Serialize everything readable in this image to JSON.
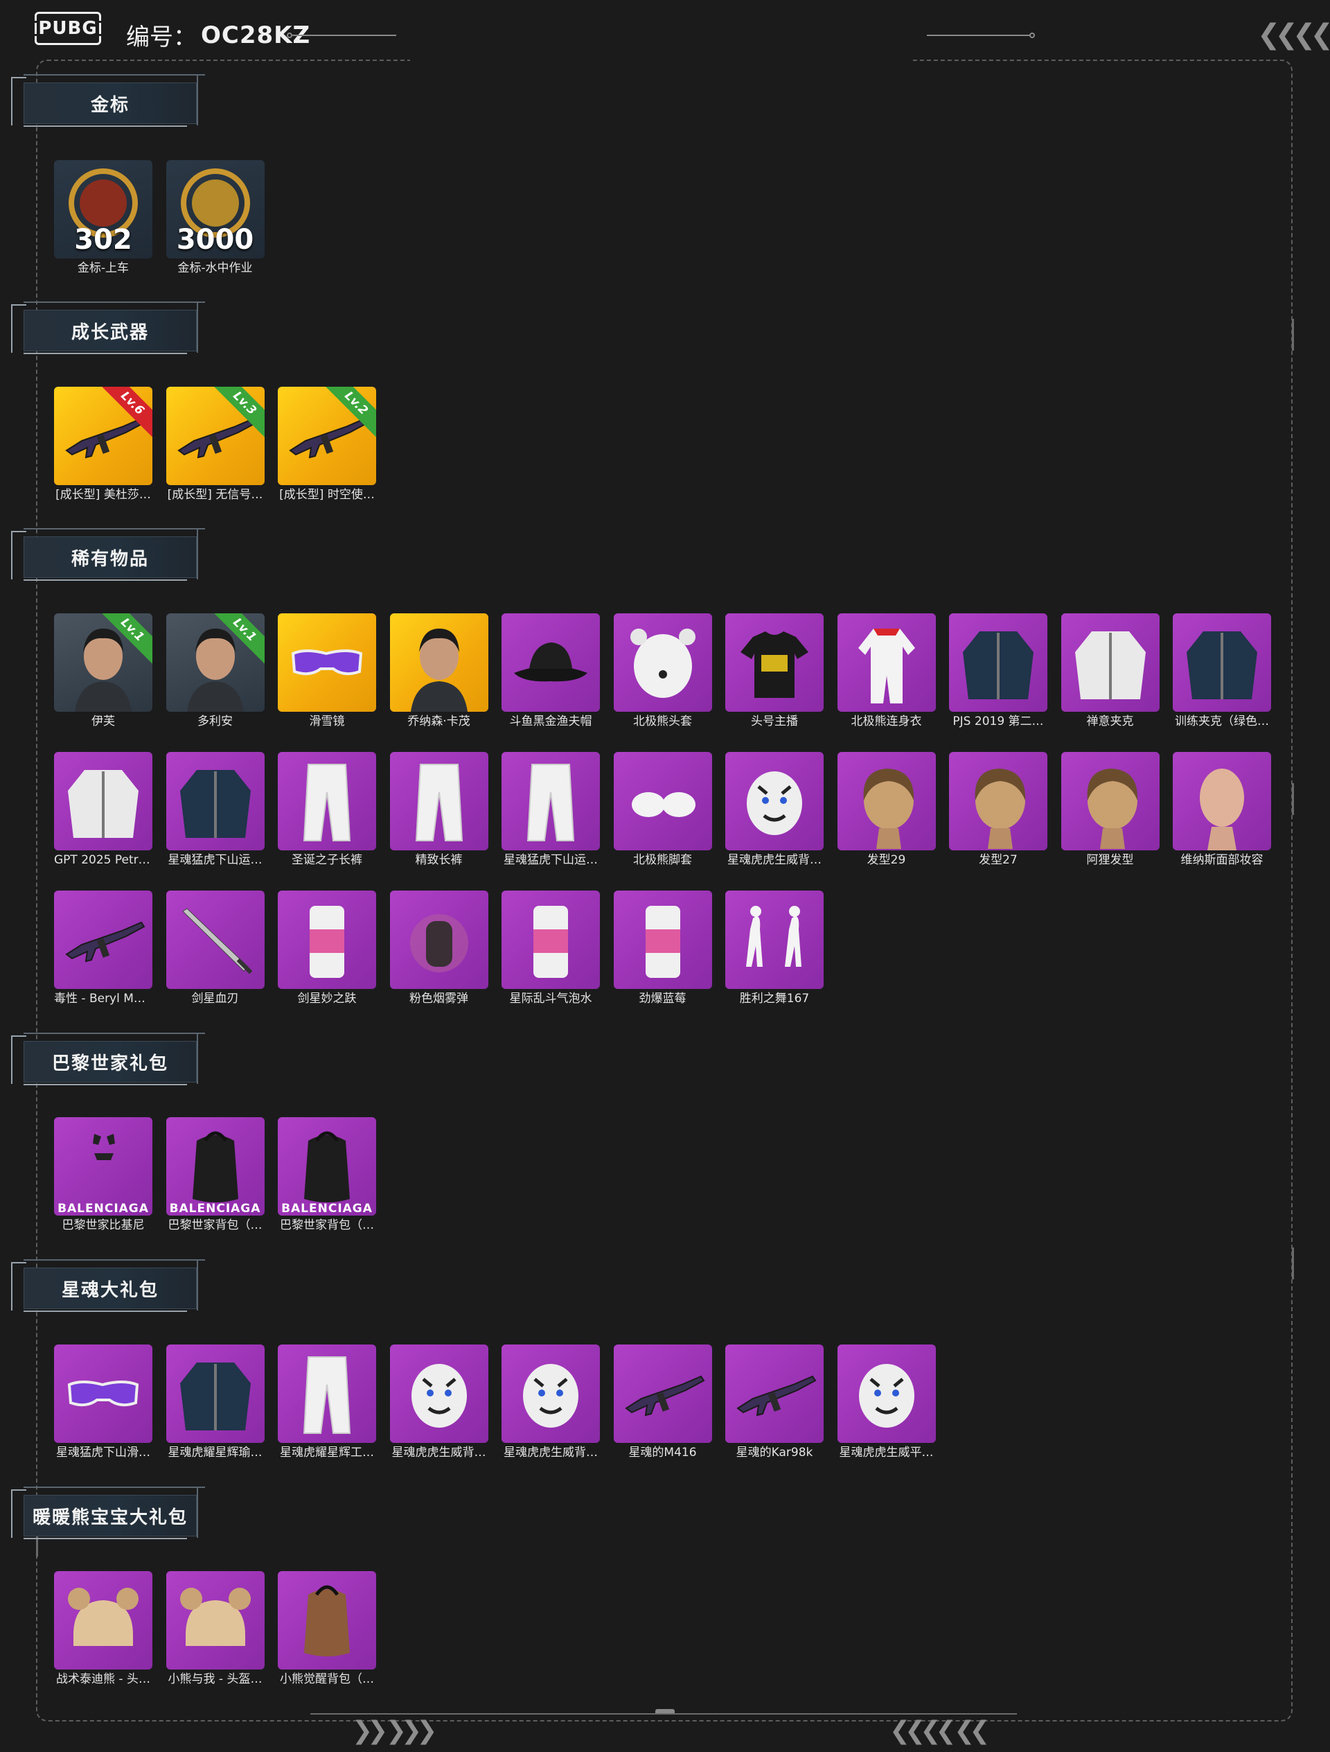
{
  "header": {
    "logo": "PUBG",
    "serial_label": "编号：",
    "serial_value": "OC28KZ"
  },
  "sections": [
    {
      "title": "金标",
      "items": [
        {
          "label": "金标-上车",
          "count": "302",
          "icon": "gold-badge-car-icon"
        },
        {
          "label": "金标-水中作业",
          "count": "3000",
          "icon": "gold-badge-seal-icon"
        }
      ]
    },
    {
      "title": "成长武器",
      "items": [
        {
          "label": "[成长型] 美杜莎…",
          "level": "Lv.6",
          "icon": "rifle-icon"
        },
        {
          "label": "[成长型] 无信号…",
          "level": "Lv.3",
          "icon": "rifle-icon"
        },
        {
          "label": "[成长型] 时空使…",
          "level": "Lv.2",
          "icon": "rifle-icon"
        }
      ]
    },
    {
      "title": "稀有物品",
      "items": [
        {
          "label": "伊芙",
          "level": "Lv.1",
          "icon": "character-portrait-icon"
        },
        {
          "label": "多利安",
          "level": "Lv.1",
          "icon": "character-portrait-icon"
        },
        {
          "label": "滑雪镜",
          "icon": "goggles-icon"
        },
        {
          "label": "乔纳森·卡茂",
          "icon": "character-portrait-icon"
        },
        {
          "label": "斗鱼黑金渔夫帽",
          "icon": "bucket-hat-icon"
        },
        {
          "label": "北极熊头套",
          "icon": "bear-head-icon"
        },
        {
          "label": "头号主播",
          "icon": "tshirt-icon"
        },
        {
          "label": "北极熊连身衣",
          "icon": "onesie-icon"
        },
        {
          "label": "PJS 2019 第二…",
          "icon": "jacket-icon"
        },
        {
          "label": "禅意夹克",
          "icon": "hoodie-icon"
        },
        {
          "label": "训练夹克（绿色…",
          "icon": "jacket-icon"
        },
        {
          "label": "GPT 2025 Petri…",
          "icon": "hoodie-icon"
        },
        {
          "label": "星魂猛虎下山运…",
          "icon": "jacket-icon"
        },
        {
          "label": "圣诞之子长裤",
          "icon": "pants-icon"
        },
        {
          "label": "精致长裤",
          "icon": "pants-icon"
        },
        {
          "label": "星魂猛虎下山运…",
          "icon": "pants-icon"
        },
        {
          "label": "北极熊脚套",
          "icon": "paws-icon"
        },
        {
          "label": "星魂虎虎生威背…",
          "icon": "tiger-backpack-icon"
        },
        {
          "label": "发型29",
          "icon": "hair-icon"
        },
        {
          "label": "发型27",
          "icon": "hair-icon"
        },
        {
          "label": "阿狸发型",
          "icon": "hair-icon"
        },
        {
          "label": "维纳斯面部妆容",
          "icon": "face-makeup-icon"
        },
        {
          "label": "毒性 - Beryl M7…",
          "icon": "rifle-icon"
        },
        {
          "label": "剑星血刃",
          "icon": "sword-icon"
        },
        {
          "label": "剑星妙之趺",
          "icon": "can-icon"
        },
        {
          "label": "粉色烟雾弹",
          "icon": "grenade-icon"
        },
        {
          "label": "星际乱斗气泡水",
          "icon": "can-icon"
        },
        {
          "label": "劲爆蓝莓",
          "icon": "can-icon"
        },
        {
          "label": "胜利之舞167",
          "icon": "dance-emote-icon"
        }
      ]
    },
    {
      "title": "巴黎世家礼包",
      "items": [
        {
          "label": "巴黎世家比基尼",
          "brand": "BALENCIAGA",
          "icon": "bikini-icon"
        },
        {
          "label": "巴黎世家背包（…",
          "brand": "BALENCIAGA",
          "icon": "backpack-icon"
        },
        {
          "label": "巴黎世家背包（…",
          "brand": "BALENCIAGA",
          "icon": "backpack-icon"
        }
      ]
    },
    {
      "title": "星魂大礼包",
      "items": [
        {
          "label": "星魂猛虎下山滑…",
          "icon": "goggles-icon"
        },
        {
          "label": "星魂虎耀星辉瑜…",
          "icon": "jacket-icon"
        },
        {
          "label": "星魂虎耀星辉工…",
          "icon": "pants-icon"
        },
        {
          "label": "星魂虎虎生威背…",
          "icon": "tiger-backpack-icon"
        },
        {
          "label": "星魂虎虎生威背…",
          "icon": "tiger-backpack-icon"
        },
        {
          "label": "星魂的M416",
          "icon": "rifle-icon"
        },
        {
          "label": "星魂的Kar98k",
          "icon": "sniper-rifle-icon"
        },
        {
          "label": "星魂虎虎生威平…",
          "icon": "tiger-pan-icon"
        }
      ]
    },
    {
      "title": "暖暖熊宝宝大礼包",
      "items": [
        {
          "label": "战术泰迪熊 - 头…",
          "icon": "bear-helmet-icon"
        },
        {
          "label": "小熊与我 - 头盔…",
          "icon": "bear-helmet-icon"
        },
        {
          "label": "小熊觉醒背包（…",
          "icon": "teddy-backpack-icon"
        }
      ]
    }
  ],
  "colors": {
    "background": "#1b1b1c",
    "tile_purple": "#a63bbf",
    "tile_gold": "#f7b611",
    "badge_red": "#d6242b",
    "badge_green": "#3aa53a"
  }
}
